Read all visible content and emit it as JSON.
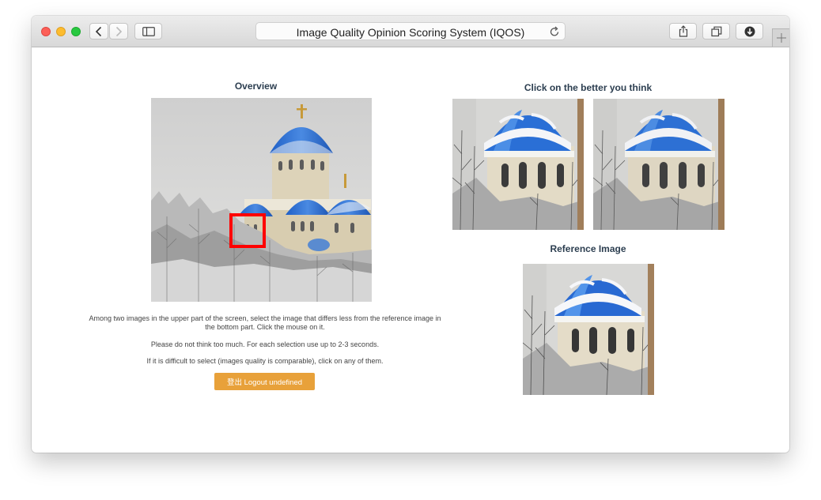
{
  "browser": {
    "title": "Image Quality Opinion Scoring System (IQOS)"
  },
  "overview": {
    "heading": "Overview"
  },
  "choice": {
    "heading": "Click on the better you think"
  },
  "reference": {
    "heading": "Reference Image"
  },
  "instructions": {
    "line1": "Among two images in the upper part of the screen, select the image that differs less from the reference image in the bottom part. Click the mouse on it.",
    "line2": "Please do not think too much. For each selection use up to 2-3 seconds.",
    "line3": "If it is difficult to select (images quality is comparable), click on any of them."
  },
  "logout_button": {
    "label": "登出 Logout undefined"
  },
  "colors": {
    "accent": "#e8a13a",
    "heading": "#2c3e50",
    "dome_blue": "#2a6fd6",
    "highlight_box": "#ff0000"
  },
  "icons": [
    "back-icon",
    "forward-icon",
    "sidebar-icon",
    "reload-icon",
    "share-icon",
    "tabs-icon",
    "download-icon",
    "plus-icon"
  ]
}
